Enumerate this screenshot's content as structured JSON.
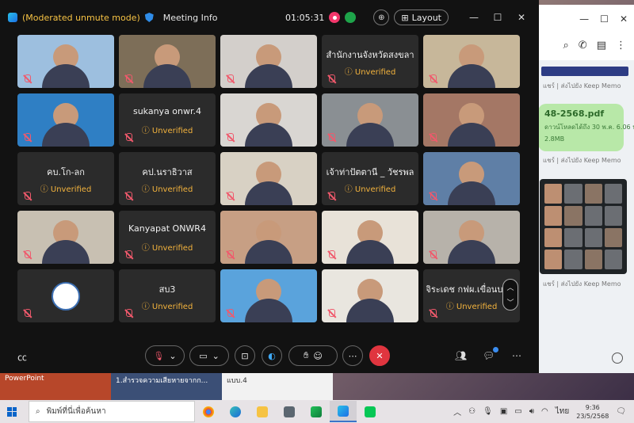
{
  "webex": {
    "mode_label": "(Moderated unmute mode)",
    "meeting_info": "Meeting Info",
    "timer": "01:05:31",
    "layout_label": "Layout",
    "scroll_up": "︿",
    "scroll_down": "﹀"
  },
  "tiles": [
    {
      "name": "",
      "unverified": "",
      "kind": "video",
      "color": "#9dbfdf"
    },
    {
      "name": "",
      "unverified": "",
      "kind": "video",
      "color": "#7d6e58"
    },
    {
      "name": "",
      "unverified": "",
      "kind": "video",
      "color": "#d3cfcb"
    },
    {
      "name": "สำนักงานจังหวัดสงขลา",
      "unverified": "Unverified",
      "kind": "name"
    },
    {
      "name": "",
      "unverified": "",
      "kind": "video",
      "color": "#c7b79a"
    },
    {
      "name": "",
      "unverified": "",
      "kind": "video",
      "color": "#2f7fc4"
    },
    {
      "name": "sukanya onwr.4",
      "unverified": "Unverified",
      "kind": "name"
    },
    {
      "name": "",
      "unverified": "",
      "kind": "video",
      "color": "#d9d6d2"
    },
    {
      "name": "",
      "unverified": "",
      "kind": "video",
      "color": "#8a8f93"
    },
    {
      "name": "",
      "unverified": "",
      "kind": "video",
      "color": "#a47765"
    },
    {
      "name": "คบ.โก-ลก",
      "unverified": "Unverified",
      "kind": "name"
    },
    {
      "name": "คป.นราธิวาส",
      "unverified": "Unverified",
      "kind": "name"
    },
    {
      "name": "",
      "unverified": "",
      "kind": "video",
      "color": "#d8d1c4"
    },
    {
      "name": "เจ้าท่าปัตตานี _ วัชรพล",
      "unverified": "Unverified",
      "kind": "name"
    },
    {
      "name": "",
      "unverified": "",
      "kind": "video",
      "color": "#5f7fa6"
    },
    {
      "name": "",
      "unverified": "",
      "kind": "video",
      "color": "#c8c0b2"
    },
    {
      "name": "Kanyapat ONWR4",
      "unverified": "Unverified",
      "kind": "name"
    },
    {
      "name": "",
      "unverified": "",
      "kind": "video",
      "color": "#c79f84"
    },
    {
      "name": "",
      "unverified": "",
      "kind": "video",
      "color": "#e8e2d8"
    },
    {
      "name": "",
      "unverified": "",
      "kind": "video",
      "color": "#b7b2aa"
    },
    {
      "name": "",
      "unverified": "",
      "kind": "avatar"
    },
    {
      "name": "สบ3",
      "unverified": "Unverified",
      "kind": "name"
    },
    {
      "name": "",
      "unverified": "",
      "kind": "video",
      "color": "#5aa3dc"
    },
    {
      "name": "",
      "unverified": "",
      "kind": "video",
      "color": "#e9e6df"
    },
    {
      "name": "จิระเดช กฟผ.เขื่อนบางล",
      "unverified": "Unverified",
      "kind": "name"
    }
  ],
  "line_chat": {
    "meta_1": "แชร์ | ส่งไปยัง Keep Memo",
    "file_name": "48-2568.pdf",
    "file_expiry": "ดาวน์โหลดได้ถึง 30 พ.ค. 6.06 น.",
    "file_size": "2.8MB",
    "meta_2": "แชร์ | ส่งไปยัง Keep Memo",
    "meta_3": "แชร์ | ส่งไปยัง Keep Memo"
  },
  "peek": {
    "ppt": "PowerPoint",
    "item2": "1.สำรวจความเสียหายจากก...",
    "item3": "แบบ.4"
  },
  "taskbar": {
    "search_placeholder": "พิมพ์ที่นี่เพื่อค้นหา",
    "lang": "ไทย",
    "time": "9:36",
    "date": "23/5/2568"
  }
}
